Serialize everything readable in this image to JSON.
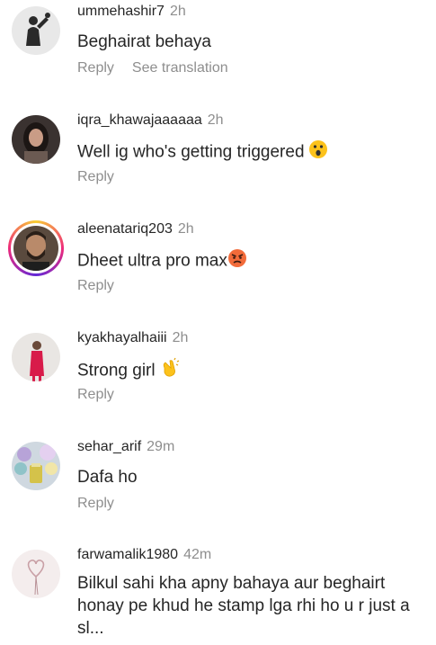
{
  "comments": [
    {
      "username": "ummehashir7",
      "time": "2h",
      "text": "Beghairat behaya",
      "reply": "Reply",
      "see_translation": "See translation",
      "avatar_icon": "silhouette-photo"
    },
    {
      "username": "iqra_khawajaaaaaa",
      "time": "2h",
      "text": "Well ig who's getting triggered",
      "emoji": "astonished-face",
      "reply": "Reply",
      "avatar_icon": "woman-photo"
    },
    {
      "username": "aleenatariq203",
      "time": "2h",
      "text": "Dheet ultra pro max",
      "emoji": "angry-face",
      "reply": "Reply",
      "avatar_icon": "bearded-man-photo",
      "story_ring": true
    },
    {
      "username": "kyakhayalhaiii",
      "time": "2h",
      "text": "Strong girl",
      "emoji": "clapping-hands",
      "reply": "Reply",
      "avatar_icon": "woman-pink-dress-photo"
    },
    {
      "username": "sehar_arif",
      "time": "29m",
      "text": "Dafa ho",
      "reply": "Reply",
      "avatar_icon": "balloons-photo"
    },
    {
      "username": "farwamalik1980",
      "time": "42m",
      "text": "Bilkul sahi kha apny bahaya aur beghairt honay pe khud he stamp lga rhi ho u r just a sl...",
      "avatar_icon": "heart-balloon-photo"
    }
  ],
  "colors": {
    "text": "#262626",
    "secondary": "#8e8e8e",
    "background": "#ffffff"
  }
}
